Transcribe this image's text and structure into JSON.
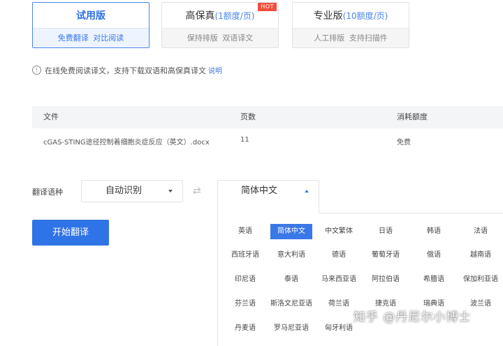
{
  "plans": [
    {
      "title": "试用版",
      "quota": "",
      "features": "免费翻译  对比阅读",
      "badge": ""
    },
    {
      "title": "高保真",
      "quota": "(1额度/页)",
      "features": "保持排版  双语译文",
      "badge": "HOT"
    },
    {
      "title": "专业版",
      "quota": "(10额度/页)",
      "features": "人工排版  支持扫描件",
      "badge": ""
    }
  ],
  "info": {
    "icon": "info-icon",
    "text": "在线免费阅读译文，支持下载双语和高保真译文",
    "link": "说明"
  },
  "table": {
    "headers": [
      "文件",
      "页数",
      "消耗额度"
    ],
    "row": {
      "file": "cGAS-STING途径控制着细胞炎症反应（英文）.docx",
      "pages": "11",
      "cost": "免费"
    }
  },
  "language": {
    "label": "翻译语种",
    "source": "自动识别",
    "swap_icon": "⇄",
    "target": "简体中文"
  },
  "language_options": [
    "英语",
    "简体中文",
    "中文繁体",
    "日语",
    "韩语",
    "法语",
    "西班牙语",
    "意大利语",
    "德语",
    "葡萄牙语",
    "俄语",
    "越南语",
    "印尼语",
    "泰语",
    "马来西亚语",
    "阿拉伯语",
    "希腊语",
    "保加利亚语",
    "芬兰语",
    "斯洛文尼亚语",
    "荷兰语",
    "捷克语",
    "瑞典语",
    "波兰语",
    "丹麦语",
    "罗马尼亚语",
    "匈牙利语"
  ],
  "selected_language": "简体中文",
  "start_button": "开始翻译",
  "watermark": "知乎 @丹尼尔小博士",
  "colors": {
    "accent": "#3b78e7",
    "hot": "#f24e3e",
    "button": "#2f74e6"
  }
}
